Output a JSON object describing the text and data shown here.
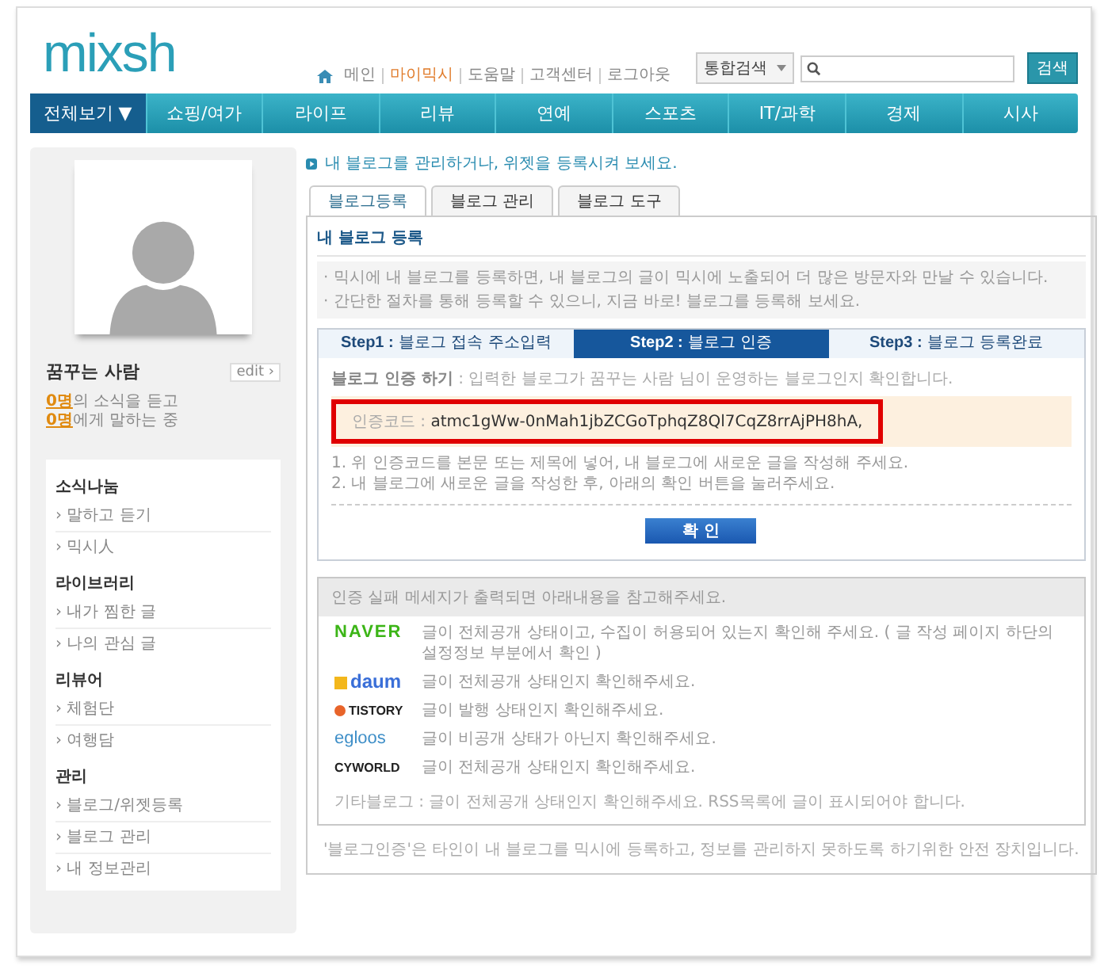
{
  "logo": "mixsh",
  "top_links": [
    {
      "label": "메인",
      "selected": false
    },
    {
      "label": "마이믹시",
      "selected": true
    },
    {
      "label": "도움말",
      "selected": false
    },
    {
      "label": "고객센터",
      "selected": false
    },
    {
      "label": "로그아웃",
      "selected": false
    }
  ],
  "search": {
    "scope": "통합검색",
    "button": "검색"
  },
  "nav": [
    {
      "label": "전체보기 ▼",
      "selected": true
    },
    {
      "label": "쇼핑/여가",
      "selected": false
    },
    {
      "label": "라이프",
      "selected": false
    },
    {
      "label": "리뷰",
      "selected": false
    },
    {
      "label": "연예",
      "selected": false
    },
    {
      "label": "스포츠",
      "selected": false
    },
    {
      "label": "IT/과학",
      "selected": false
    },
    {
      "label": "경제",
      "selected": false
    },
    {
      "label": "시사",
      "selected": false
    }
  ],
  "profile": {
    "name": "꿈꾸는 사람",
    "edit": "edit ›",
    "stats": [
      {
        "count": "0명",
        "text": "의 소식을 듣고"
      },
      {
        "count": "0명",
        "text": "에게 말하는 중"
      }
    ]
  },
  "sidebar": [
    {
      "heading": "소식나눔",
      "items": [
        "› 말하고 듣기",
        "› 믹시人"
      ]
    },
    {
      "heading": "라이브러리",
      "items": [
        "› 내가 찜한 글",
        "› 나의 관심 글"
      ]
    },
    {
      "heading": "리뷰어",
      "items": [
        "› 체험단",
        "› 여행담"
      ]
    },
    {
      "heading": "관리",
      "items": [
        "› 블로그/위젯등록",
        "› 블로그 관리",
        "› 내 정보관리"
      ]
    }
  ],
  "intro": "내 블로그를 관리하거나, 위젯을 등록시켜 보세요.",
  "tabs": [
    {
      "label": "블로그등록",
      "selected": true
    },
    {
      "label": "블로그 관리",
      "selected": false
    },
    {
      "label": "블로그 도구",
      "selected": false
    }
  ],
  "section_title": "내 블로그 등록",
  "notes": [
    "· 믹시에 내 블로그를 등록하면, 내 블로그의 글이 믹시에 노출되어 더 많은 방문자와 만날 수 있습니다.",
    "· 간단한 절차를 통해 등록할 수 있으니, 지금 바로! 블로그를 등록해 보세요."
  ],
  "steps": [
    {
      "label": "Step1 :",
      "text": "블로그 접속 주소입력",
      "selected": false
    },
    {
      "label": "Step2 :",
      "text": "블로그 인증",
      "selected": true
    },
    {
      "label": "Step3 :",
      "text": "블로그 등록완료",
      "selected": false
    }
  ],
  "verify": {
    "title": "블로그 인증 하기",
    "desc": " : 입력한 블로그가 꿈꾸는 사람 님이 운영하는 블로그인지 확인합니다.",
    "code_label": "인증코드 : ",
    "code": "atmc1gWw-0nMah1jbZCGoTphqZ8Ql7CqZ8rrAjPH8hA,",
    "highlighted": true,
    "instructions": [
      "1. 위 인증코드를 본문 또는 제목에 넣어, 내 블로그에 새로운 글을 작성해 주세요.",
      "2. 내 블로그에 새로운 글을 작성한 후, 아래의 확인 버튼을 눌러주세요."
    ],
    "button": "확 인"
  },
  "help": {
    "title": "인증 실패 메세지가 출력되면 아래내용을 참고해주세요.",
    "services": [
      {
        "logo": "NAVER",
        "kind": "text-logo",
        "color": "#3cb517",
        "text": "글이 전체공개 상태이고, 수집이 허용되어 있는지 확인해 주세요. ( 글 작성 페이지 하단의 설정정보 부분에서 확인 )"
      },
      {
        "logo": "daum",
        "kind": "block-logo",
        "color": "#3a6fd8",
        "text": "글이 전체공개 상태인지 확인해주세요."
      },
      {
        "logo": "TISTORY",
        "kind": "circle-logo",
        "color": "#222222",
        "text": "글이 발행 상태인지 확인해주세요."
      },
      {
        "logo": "egloos",
        "kind": "text-logo",
        "color": "#3f8fc8",
        "text": "글이 비공개 상태가 아닌지 확인해주세요."
      },
      {
        "logo": "CYWORLD",
        "kind": "text-logo",
        "color": "#222222",
        "text": "글이 전체공개 상태인지 확인해주세요."
      }
    ],
    "other": "기타블로그 : 글이 전체공개 상태인지 확인해주세요. RSS목록에 글이 표시되어야 합니다."
  },
  "footnote": "'블로그인증'은 타인이 내 블로그를 믹시에 등록하고, 정보를 관리하지 못하도록 하기위한 안전 장치입니다."
}
